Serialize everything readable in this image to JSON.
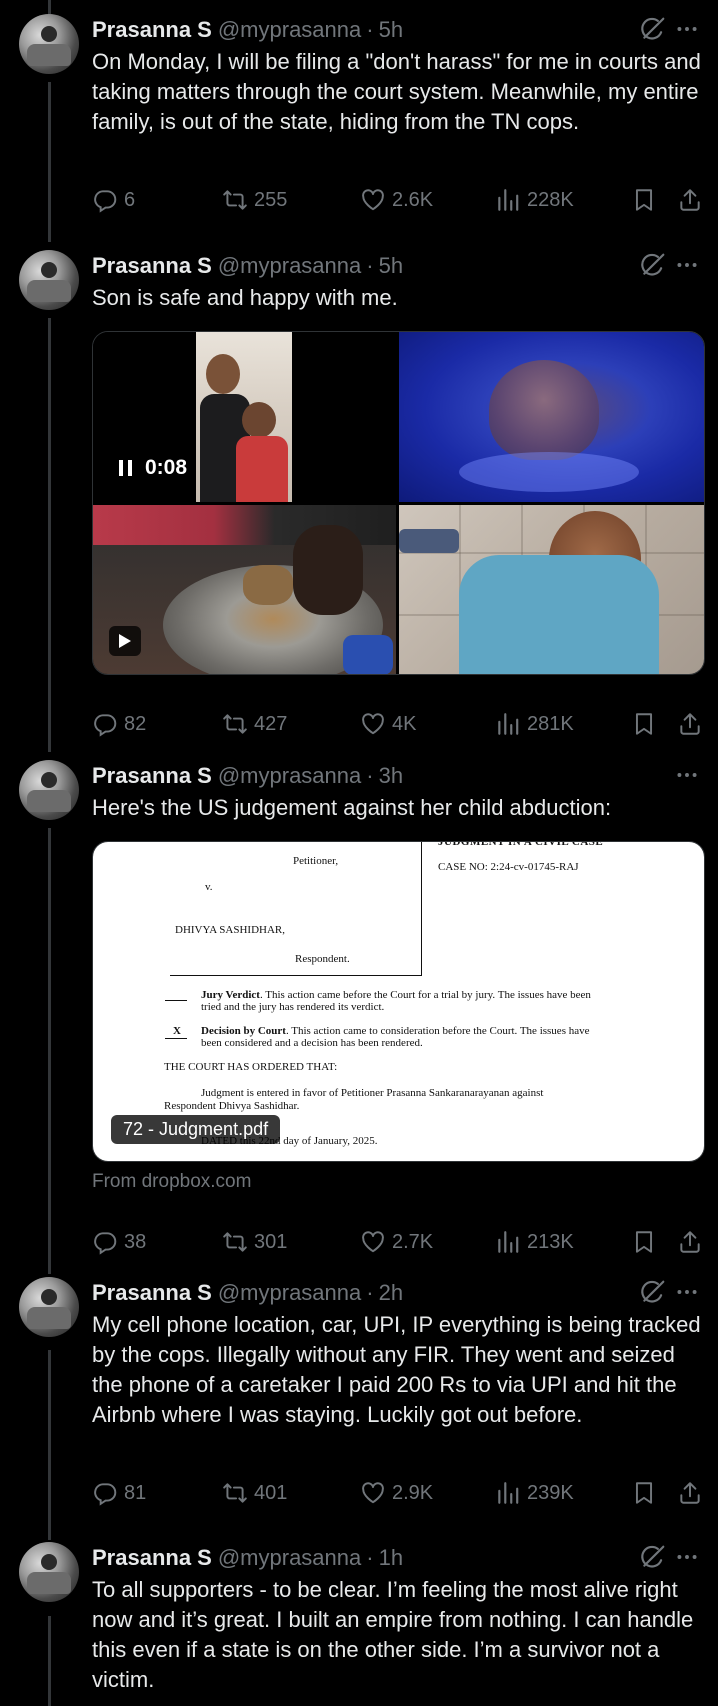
{
  "tweets": [
    {
      "name": "Prasanna S",
      "handle": "@myprasanna",
      "time": "5h",
      "text": "On Monday, I will be filing a \"don't harass\" for me in courts and taking matters through the court system. Meanwhile, my entire family, is out of the state, hiding from the TN cops.",
      "stats": {
        "replies": "6",
        "reposts": "255",
        "likes": "2.6K",
        "views": "228K"
      }
    },
    {
      "name": "Prasanna S",
      "handle": "@myprasanna",
      "time": "5h",
      "text": "Son is safe and happy with me.",
      "media": {
        "video_duration": "0:08"
      },
      "stats": {
        "replies": "82",
        "reposts": "427",
        "likes": "4K",
        "views": "281K"
      }
    },
    {
      "name": "Prasanna S",
      "handle": "@myprasanna",
      "time": "3h",
      "text": "Here's the US judgement against her child abduction:",
      "document": {
        "filename": "72 - Judgment.pdf",
        "source": "From dropbox.com",
        "lines": {
          "heading": "JUDGMENT IN A CIVIL CASE",
          "petitioner": "Petitioner,",
          "v": "v.",
          "case_no": "CASE NO: 2:24-cv-01745-RAJ",
          "respondent_name": "DHIVYA SASHIDHAR,",
          "respondent": "Respondent.",
          "jury_title": "Jury Verdict",
          "jury_text_1": ". This action came before the Court for a trial by jury.  The issues have been",
          "jury_text_2": "tried and the jury has rendered its verdict.",
          "x_mark": "X",
          "decision_title": "Decision by Court",
          "decision_text_1": ".  This action came to consideration before the Court.  The issues have",
          "decision_text_2": "been considered and a decision has been rendered.",
          "ordered": "THE COURT HAS ORDERED THAT:",
          "judgment_1": "Judgment is entered in favor of Petitioner Prasanna Sankaranarayanan against",
          "judgment_2": "Respondent Dhivya Sashidhar.",
          "dated": "DATED this 22nd day of January, 2025."
        }
      },
      "stats": {
        "replies": "38",
        "reposts": "301",
        "likes": "2.7K",
        "views": "213K"
      }
    },
    {
      "name": "Prasanna S",
      "handle": "@myprasanna",
      "time": "2h",
      "text": "My cell phone location, car, UPI, IP everything is being tracked by the cops. Illegally without any FIR. They went and seized the phone of a caretaker I paid 200 Rs to via UPI and hit the Airbnb where I was staying. Luckily got out before.",
      "stats": {
        "replies": "81",
        "reposts": "401",
        "likes": "2.9K",
        "views": "239K"
      }
    },
    {
      "name": "Prasanna S",
      "handle": "@myprasanna",
      "time": "1h",
      "text": "To all supporters - to be clear. I’m feeling the most alive right now and it’s great. I built an empire from nothing. I can handle this even if a state is on the other side. I’m a survivor not a victim."
    }
  ],
  "separator": "·",
  "icons": {
    "grok": "grok-icon",
    "more": "more-icon",
    "reply": "reply-icon",
    "repost": "repost-icon",
    "like": "like-icon",
    "views": "views-icon",
    "bookmark": "bookmark-icon",
    "share": "share-icon"
  },
  "colors": {
    "background": "#000000",
    "text": "#e7e9ea",
    "muted": "#71767b",
    "thread_line": "#333639"
  }
}
